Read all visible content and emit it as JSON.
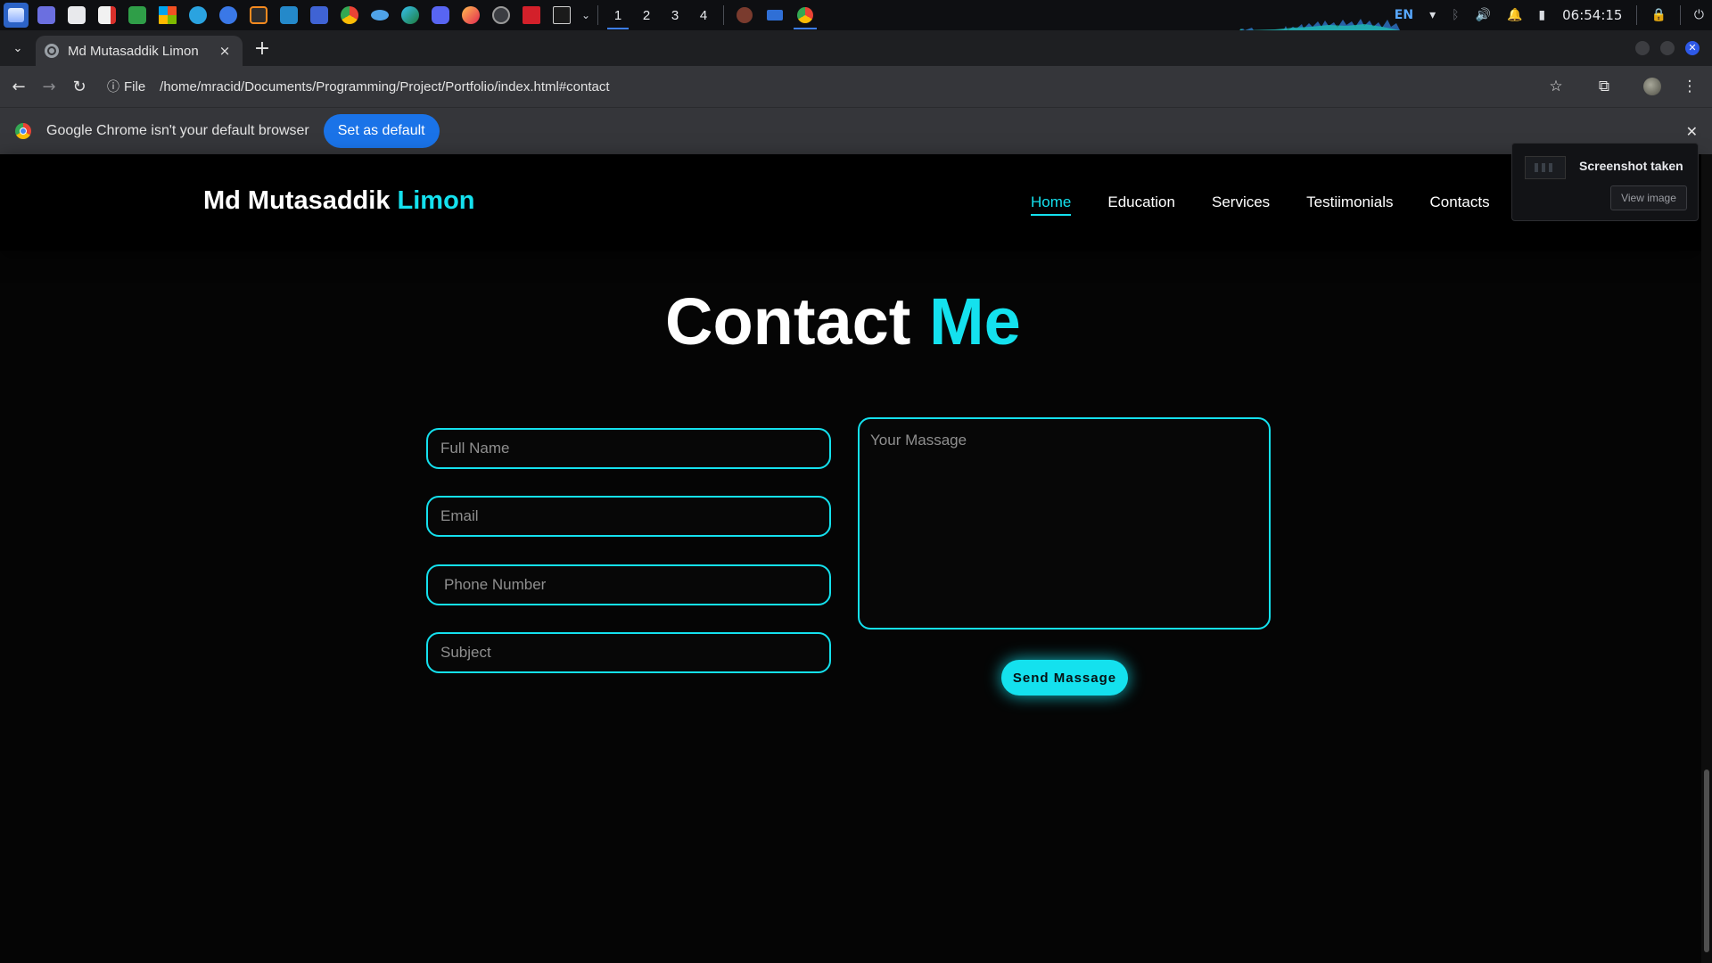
{
  "taskbar": {
    "workspaces": [
      "1",
      "2",
      "3",
      "4"
    ],
    "tray": {
      "lang": "EN",
      "clock": "06:54:15"
    }
  },
  "browser": {
    "tab_title": "Md Mutasaddik Limon",
    "tab_close": "×",
    "new_tab": "+",
    "omnibox_chip": "File",
    "url": "/home/mracid/Documents/Programming/Project/Portfolio/index.html#contact"
  },
  "infobar": {
    "message": "Google Chrome isn't your default browser",
    "button": "Set as default",
    "close": "✕"
  },
  "site": {
    "logo_first": "Md Mutasaddik",
    "logo_accent": "Limon",
    "nav": [
      "Home",
      "Education",
      "Services",
      "Testiimonials",
      "Contacts"
    ],
    "heading_first": "Contact",
    "heading_accent": "Me",
    "form": {
      "full_name": "Full Name",
      "email": "Email",
      "phone": "Phone Number",
      "subject": "Subject",
      "message": "Your Massage",
      "send": "Send Massage"
    },
    "accent_color": "#14e1ee"
  },
  "notification": {
    "title": "Screenshot taken",
    "button": "View image"
  }
}
